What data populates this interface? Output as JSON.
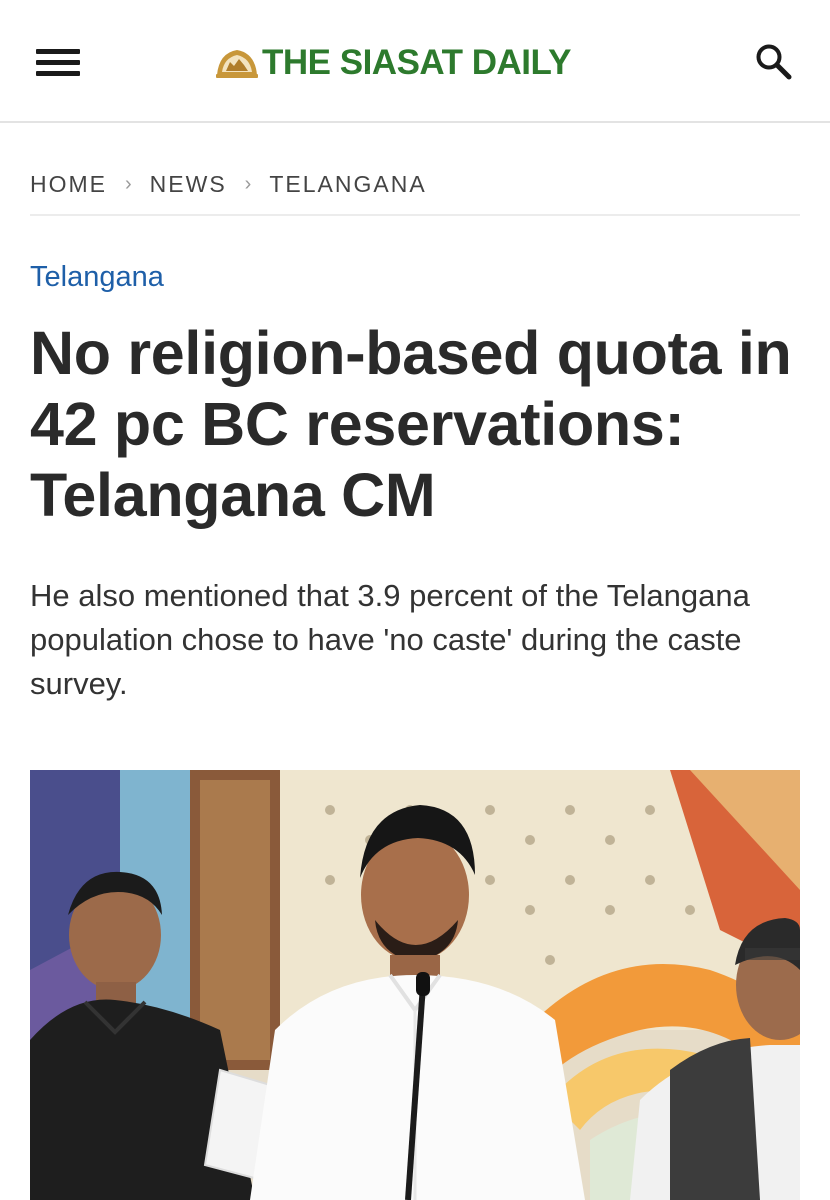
{
  "header": {
    "logo_text": "THE SIASAT DAILY",
    "menu_icon": "hamburger-menu-icon",
    "search_icon": "search-icon",
    "brand_color": "#2d7a2d",
    "logo_accent": "#c8973a"
  },
  "breadcrumb": {
    "items": [
      "HOME",
      "NEWS",
      "TELANGANA"
    ],
    "separator": "›"
  },
  "article": {
    "category": "Telangana",
    "category_color": "#1e5fa8",
    "headline": "No religion-based quota in 42 pc BC reservations: Telangana CM",
    "subtitle": "He also mentioned that 3.9 percent of the Telangana population chose to have 'no caste' during the caste survey."
  }
}
